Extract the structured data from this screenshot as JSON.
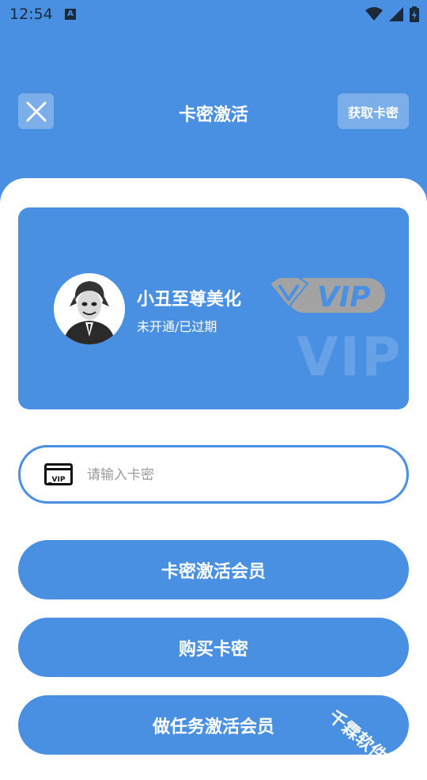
{
  "status_bar": {
    "time": "12:54",
    "notification_glyph": "A"
  },
  "header": {
    "title": "卡密激活",
    "get_card_label": "获取卡密"
  },
  "vip_card": {
    "name": "小丑至尊美化",
    "status": "未开通/已过期",
    "badge_text": "VIP",
    "watermark_text": "VIP"
  },
  "card_input": {
    "value": "",
    "placeholder": "请输入卡密",
    "icon_text": "_VIP"
  },
  "buttons": {
    "activate": "卡密激活会员",
    "buy": "购买卡密",
    "task_activate": "做任务激活会员"
  },
  "corner_watermark": "千霖软件站",
  "colors": {
    "primary": "#4A90E2",
    "background": "#FFFFFF",
    "text_on_primary": "#FFFFFF"
  }
}
